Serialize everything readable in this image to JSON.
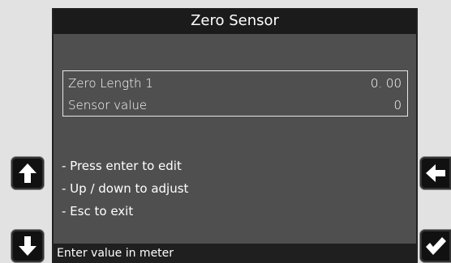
{
  "screen": {
    "title": "Zero Sensor",
    "values": [
      {
        "label": "Zero Length 1",
        "value": "0. 00"
      },
      {
        "label": "Sensor value",
        "value": "0"
      }
    ],
    "instructions": [
      "- Press enter to edit",
      "- Up / down to adjust",
      "- Esc to exit"
    ],
    "status": "Enter value in meter"
  },
  "buttons": {
    "up_icon": "arrow-up-icon",
    "down_icon": "arrow-down-icon",
    "back_icon": "arrow-left-icon",
    "ok_icon": "checkmark-icon"
  },
  "colors": {
    "screen_bg": "#4f4f4f",
    "title_bar_bg": "#1b1b1b",
    "status_bar_bg": "#1f1f1f",
    "bezel": "#e2e2e2",
    "button_bg": "#111111",
    "text": "#ffffff"
  }
}
